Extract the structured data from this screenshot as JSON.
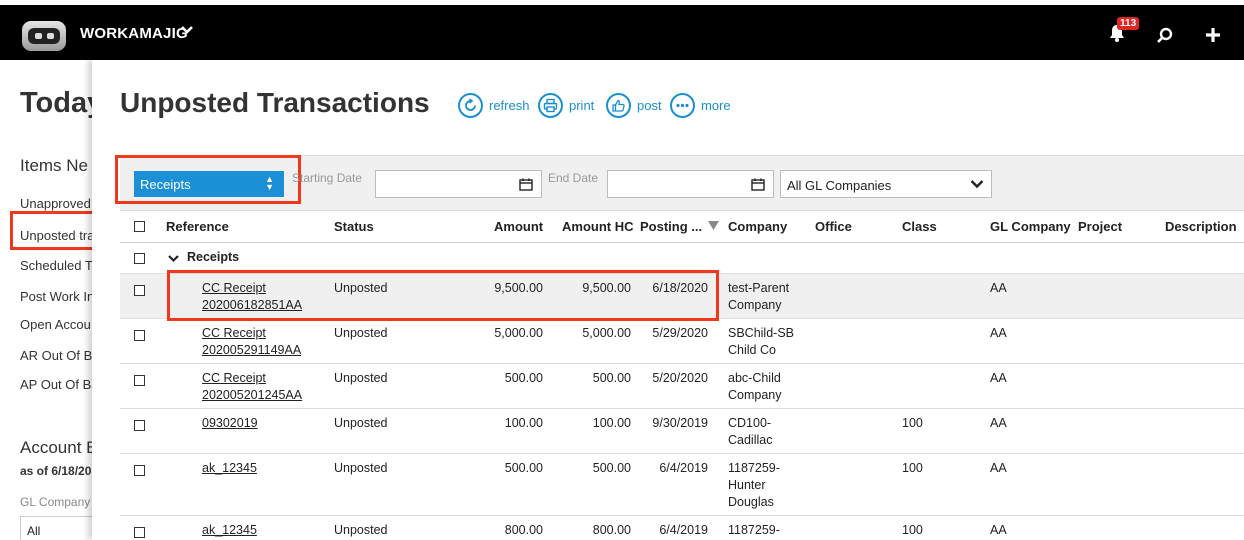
{
  "app": {
    "brand": "WORKAMAJIG",
    "notification_count": "113"
  },
  "background_page": {
    "title": "Today",
    "section": "Items Ne",
    "links": [
      "Unapproved",
      "Unposted tra",
      "Scheduled T",
      "Post Work In",
      "Open Accou",
      "AR Out Of Ba",
      "AP Out Of Ba"
    ],
    "account_title": "Account B",
    "as_of": "as of 6/18/20",
    "gl_company_label": "GL Company",
    "gl_company_value": "All"
  },
  "page": {
    "title": "Unposted Transactions",
    "actions": {
      "refresh": "refresh",
      "print": "print",
      "post": "post",
      "more": "more"
    }
  },
  "filters": {
    "type": "Receipts",
    "start_date_label": "Starting Date",
    "start_date_value": "",
    "end_date_label": "End Date",
    "end_date_value": "",
    "gl_companies": "All GL Companies"
  },
  "table": {
    "headers": {
      "reference": "Reference",
      "status": "Status",
      "amount": "Amount",
      "amount_hc": "Amount HC",
      "posting": "Posting ...",
      "company": "Company",
      "office": "Office",
      "class": "Class",
      "gl_company": "GL Company",
      "project": "Project",
      "description": "Description"
    },
    "group": "Receipts",
    "rows": [
      {
        "ref1": "CC Receipt",
        "ref2": "202006182851AA",
        "status": "Unposted",
        "amount": "9,500.00",
        "amount_hc": "9,500.00",
        "posting": "6/18/2020",
        "company1": "test-Parent",
        "company2": "Company",
        "company3": "",
        "class": "",
        "gl": "AA"
      },
      {
        "ref1": "CC Receipt",
        "ref2": "202005291149AA",
        "status": "Unposted",
        "amount": "5,000.00",
        "amount_hc": "5,000.00",
        "posting": "5/29/2020",
        "company1": "SBChild-SB",
        "company2": "Child Co",
        "company3": "",
        "class": "",
        "gl": "AA"
      },
      {
        "ref1": "CC Receipt",
        "ref2": "202005201245AA",
        "status": "Unposted",
        "amount": "500.00",
        "amount_hc": "500.00",
        "posting": "5/20/2020",
        "company1": "abc-Child",
        "company2": "Company",
        "company3": "",
        "class": "",
        "gl": "AA"
      },
      {
        "ref1": "09302019",
        "ref2": "",
        "status": "Unposted",
        "amount": "100.00",
        "amount_hc": "100.00",
        "posting": "9/30/2019",
        "company1": "CD100-",
        "company2": "Cadillac",
        "company3": "",
        "class": "100",
        "gl": "AA"
      },
      {
        "ref1": "ak_12345",
        "ref2": "",
        "status": "Unposted",
        "amount": "500.00",
        "amount_hc": "500.00",
        "posting": "6/4/2019",
        "company1": "1187259-",
        "company2": "Hunter",
        "company3": "Douglas",
        "class": "100",
        "gl": "AA"
      },
      {
        "ref1": "ak_12345",
        "ref2": "",
        "status": "Unposted",
        "amount": "800.00",
        "amount_hc": "800.00",
        "posting": "6/4/2019",
        "company1": "1187259-",
        "company2": "",
        "company3": "",
        "class": "100",
        "gl": "AA"
      }
    ]
  }
}
